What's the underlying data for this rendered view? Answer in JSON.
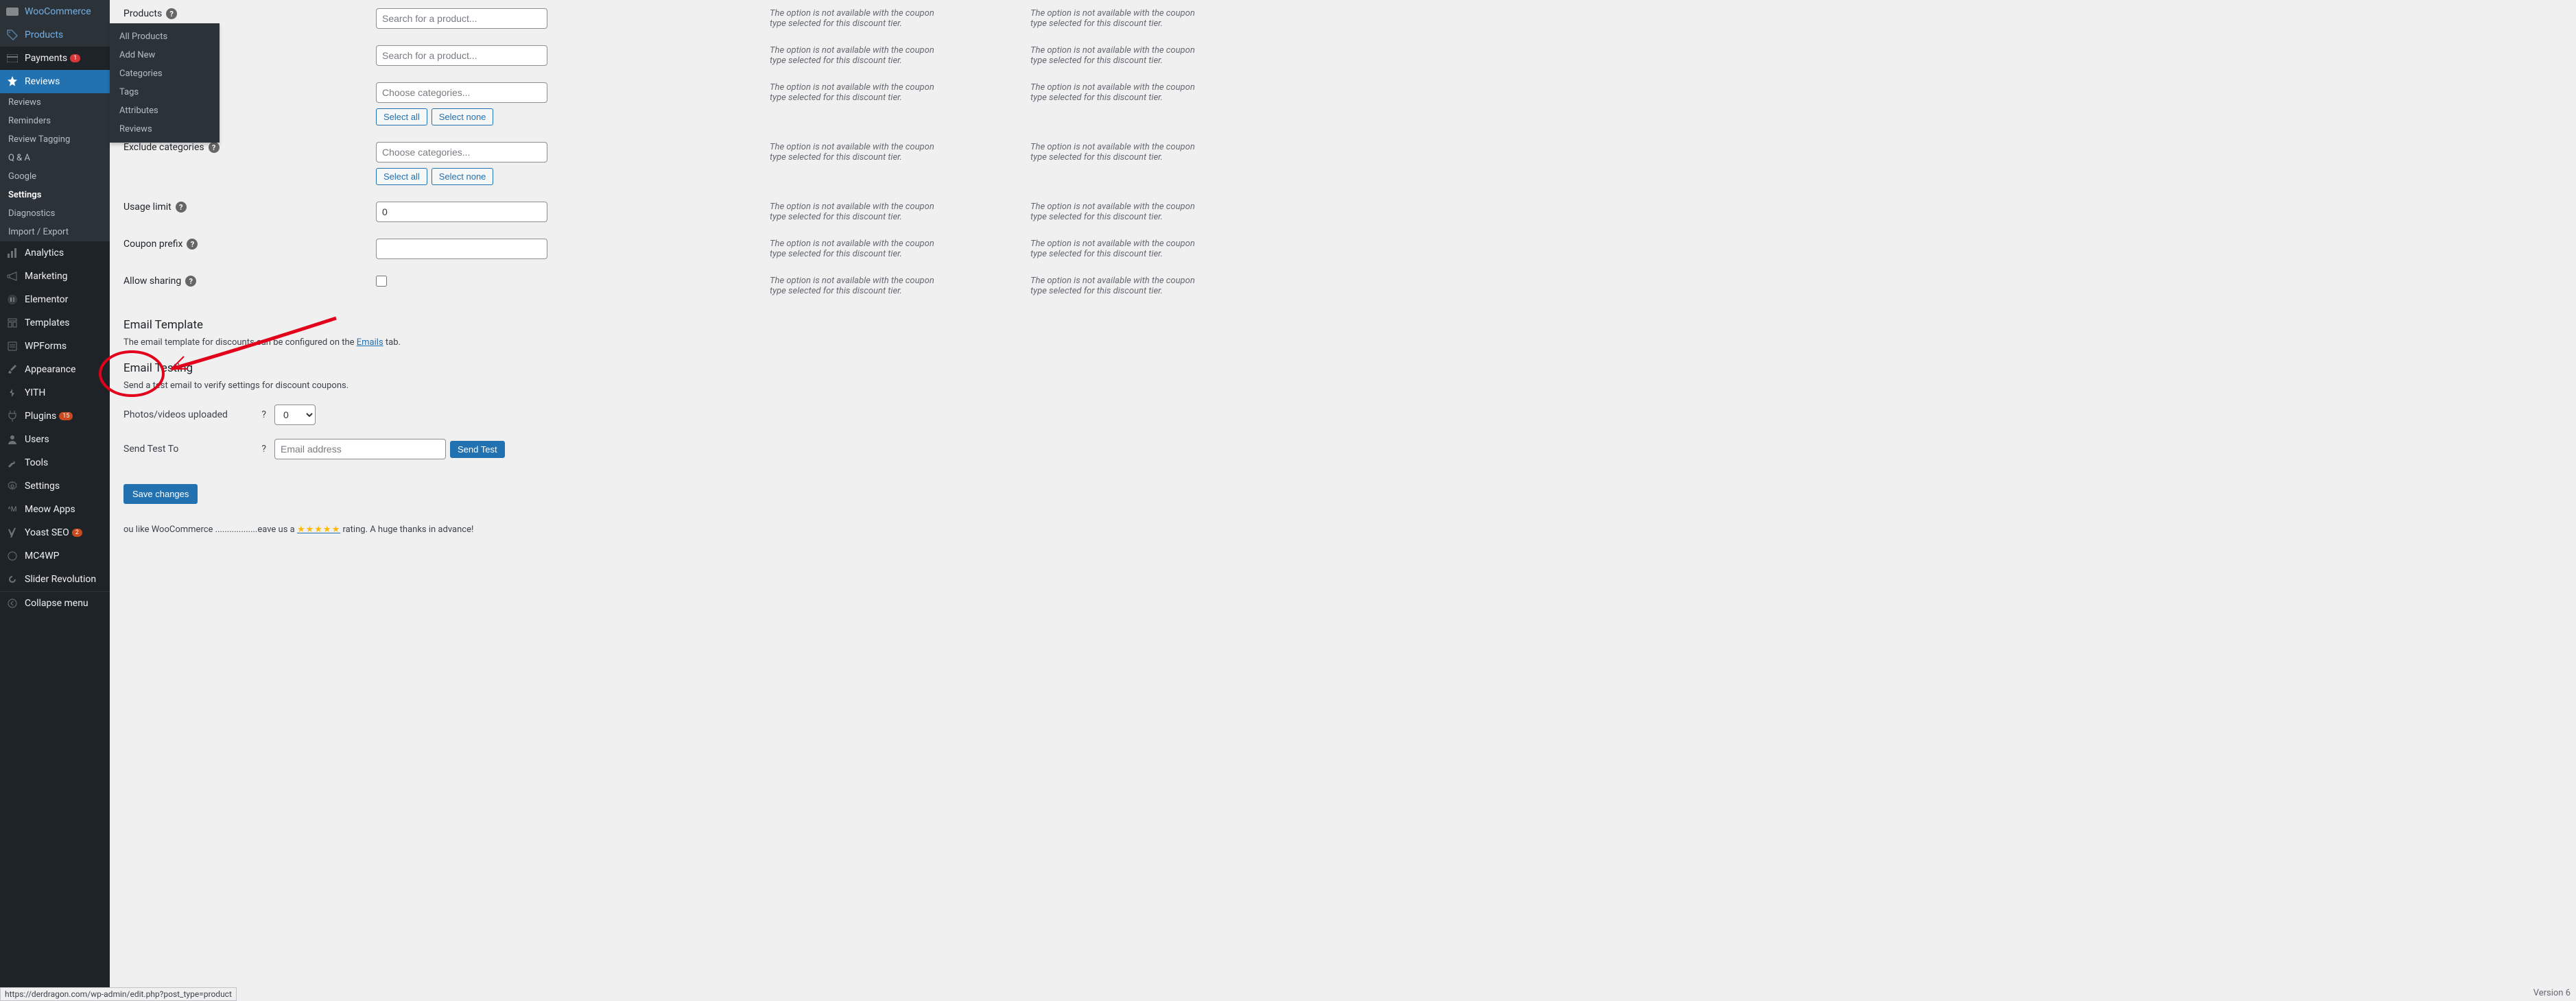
{
  "sidebar": {
    "items": [
      {
        "label": "WooCommerce",
        "icon": "wc"
      },
      {
        "label": "Products",
        "icon": "prod",
        "flyout": true
      },
      {
        "label": "Payments",
        "icon": "pay",
        "badge": "1"
      },
      {
        "label": "Reviews",
        "icon": "star",
        "current": true
      }
    ],
    "reviews_sub": [
      {
        "label": "Reviews"
      },
      {
        "label": "Reminders"
      },
      {
        "label": "Review Tagging"
      },
      {
        "label": "Q & A"
      },
      {
        "label": "Google"
      },
      {
        "label": "Settings",
        "current": true
      },
      {
        "label": "Diagnostics"
      },
      {
        "label": "Import / Export"
      }
    ],
    "lower": [
      {
        "label": "Analytics",
        "icon": "chart"
      },
      {
        "label": "Marketing",
        "icon": "mega"
      },
      {
        "label": "Elementor",
        "icon": "elem"
      },
      {
        "label": "Templates",
        "icon": "tmpl"
      },
      {
        "label": "WPForms",
        "icon": "wpf"
      },
      {
        "label": "Appearance",
        "icon": "brush"
      },
      {
        "label": "YITH",
        "icon": "yith"
      },
      {
        "label": "Plugins",
        "icon": "plug",
        "badge": "15",
        "badge_orange": true
      },
      {
        "label": "Users",
        "icon": "user"
      },
      {
        "label": "Tools",
        "icon": "wrench"
      },
      {
        "label": "Settings",
        "icon": "gear"
      },
      {
        "label": "Meow Apps",
        "icon": "meow"
      },
      {
        "label": "Yoast SEO",
        "icon": "yoast",
        "badge": "2",
        "badge_orange": true
      },
      {
        "label": "MC4WP",
        "icon": "mc4wp"
      },
      {
        "label": "Slider Revolution",
        "icon": "slider"
      }
    ],
    "collapse": "Collapse menu"
  },
  "flyout": {
    "items": [
      "All Products",
      "Add New",
      "Categories",
      "Tags",
      "Attributes",
      "Reviews"
    ]
  },
  "form": {
    "labels": {
      "products": "Products",
      "exclude_categories": "Exclude categories",
      "usage_limit": "Usage limit",
      "coupon_prefix": "Coupon prefix",
      "allow_sharing": "Allow sharing"
    },
    "placeholders": {
      "search_product": "Search for a product...",
      "choose_categories": "Choose categories..."
    },
    "values": {
      "usage_limit": "0"
    },
    "buttons": {
      "select_all": "Select all",
      "select_none": "Select none"
    },
    "note": "The option is not available with the coupon type selected for this discount tier."
  },
  "sections": {
    "email_template_title": "Email Template",
    "email_template_desc_pre": "The email template for discounts can be configured on the ",
    "email_template_link": "Emails",
    "email_template_desc_post": " tab.",
    "email_testing_title": "Email Testing",
    "email_testing_desc": "Send a test email to verify settings for discount coupons.",
    "photos_label": "Photos/videos uploaded",
    "photos_value": "0",
    "send_to_label": "Send Test To",
    "send_to_placeholder": "Email address",
    "send_test_btn": "Send Test",
    "save_btn": "Save changes"
  },
  "footer": {
    "thank_pre": "ou like WooCommerce ..................eave us a ",
    "stars": "★★★★★",
    "thank_post": " rating. A huge thanks in advance!",
    "version": "Version 6",
    "status_url": "https://derdragon.com/wp-admin/edit.php?post_type=product"
  }
}
